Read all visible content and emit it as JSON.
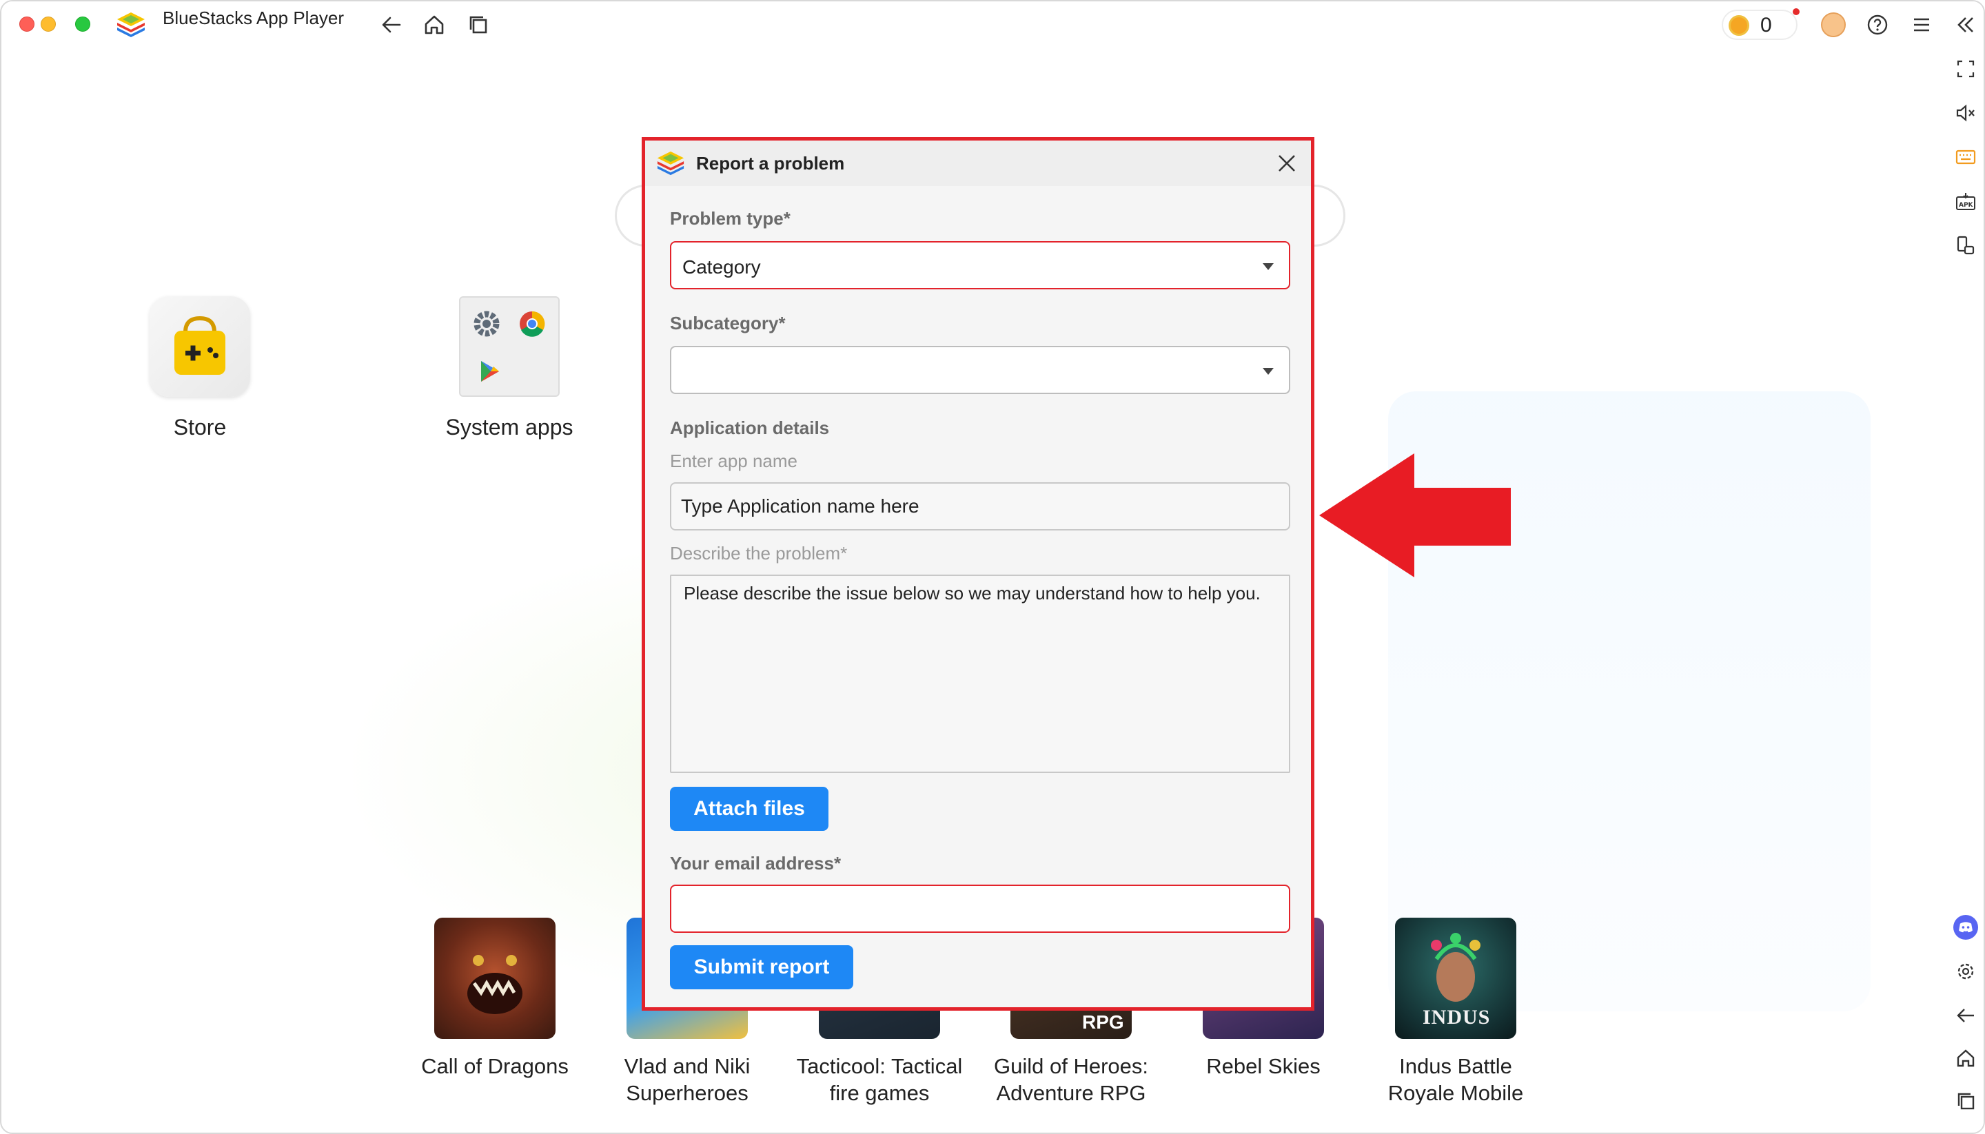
{
  "window": {
    "title": "BlueStacks App Player"
  },
  "toolbar": {
    "coin_count": "0"
  },
  "home": {
    "apps": [
      {
        "label": "Store"
      },
      {
        "label": "System apps"
      }
    ],
    "games": [
      {
        "line1": "Call of Dragons",
        "line2": ""
      },
      {
        "line1": "Vlad and Niki",
        "line2": "Superheroes"
      },
      {
        "line1": "Tacticool: Tactical",
        "line2": "fire games"
      },
      {
        "line1": "Guild of Heroes:",
        "line2": "Adventure RPG",
        "badge": "RPG"
      },
      {
        "line1": "Rebel Skies",
        "line2": ""
      },
      {
        "line1": "Indus Battle",
        "line2": "Royale Mobile",
        "badge": "INDUS"
      }
    ]
  },
  "dialog": {
    "title": "Report a problem",
    "problem_type_label": "Problem type*",
    "problem_type_value": "Category",
    "subcategory_label": "Subcategory*",
    "subcategory_value": "",
    "app_details_label": "Application details",
    "app_name_label": "Enter app name",
    "app_name_value": "Type Application name here",
    "describe_label": "Describe the problem*",
    "describe_value": "Please describe the issue below so we may understand how to help you.",
    "attach_button": "Attach files",
    "email_label": "Your email address*",
    "email_value": "",
    "submit_button": "Submit report"
  },
  "colors": {
    "accent": "#1e88f5",
    "error": "#e3232b",
    "annotation_arrow": "#e81c24"
  }
}
